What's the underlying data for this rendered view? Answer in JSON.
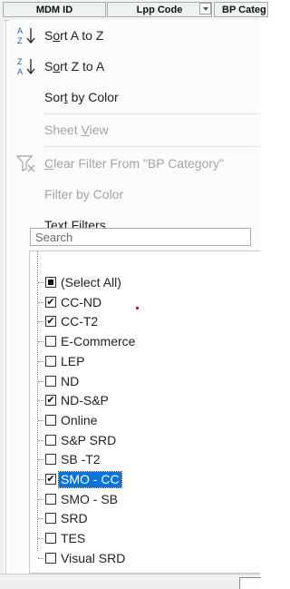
{
  "header": {
    "columns": [
      {
        "label": "MDM ID"
      },
      {
        "label": "Lpp Code"
      },
      {
        "label": "BP Categ"
      }
    ]
  },
  "menu": {
    "sort_az": {
      "prefix": "S",
      "underline": "o",
      "rest": "rt A to Z"
    },
    "sort_za": {
      "prefix": "S",
      "underline": "o",
      "rest": "rt Z to A"
    },
    "sort_color": {
      "prefix": "Sor",
      "underline": "t",
      "rest": " by Color"
    },
    "sheet_view": {
      "prefix": "Sheet ",
      "underline": "V",
      "rest": "iew"
    },
    "clear_filter": {
      "prefix": "",
      "underline": "C",
      "rest": "lear Filter From \"BP Category\""
    },
    "filter_color": {
      "prefix": "Filter by Color"
    },
    "text_filters": {
      "prefix": "Text ",
      "underline": "F",
      "rest": "ilters"
    }
  },
  "search": {
    "placeholder": "Search"
  },
  "items": [
    {
      "label": "(Select All)",
      "state": "partial"
    },
    {
      "label": "CC-ND",
      "state": "checked"
    },
    {
      "label": "CC-T2",
      "state": "checked"
    },
    {
      "label": "E-Commerce",
      "state": "unchecked"
    },
    {
      "label": "LEP",
      "state": "unchecked"
    },
    {
      "label": "ND",
      "state": "unchecked"
    },
    {
      "label": "ND-S&P",
      "state": "checked"
    },
    {
      "label": "Online",
      "state": "unchecked"
    },
    {
      "label": "S&P SRD",
      "state": "unchecked"
    },
    {
      "label": "SB -T2",
      "state": "unchecked"
    },
    {
      "label": "SMO - CC",
      "state": "checked",
      "selected": true
    },
    {
      "label": "SMO - SB",
      "state": "unchecked"
    },
    {
      "label": "SRD",
      "state": "unchecked"
    },
    {
      "label": "TES",
      "state": "unchecked"
    },
    {
      "label": "Visual SRD",
      "state": "unchecked"
    }
  ],
  "colors": {
    "selection": "#0a74d8",
    "disabled_text": "#a4a4a4"
  }
}
